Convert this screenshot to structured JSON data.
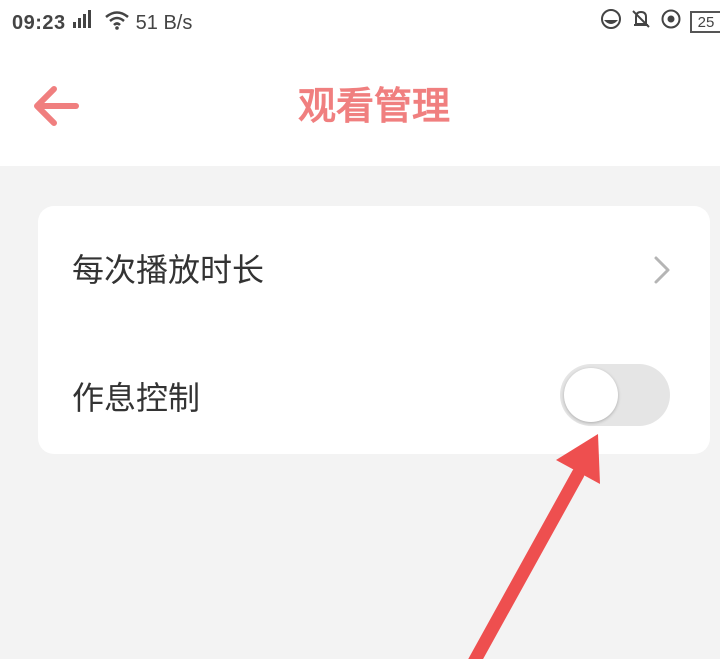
{
  "status_bar": {
    "time": "09:23",
    "network_speed": "51 B/s",
    "battery_level": "25"
  },
  "header": {
    "title": "观看管理"
  },
  "settings": {
    "items": [
      {
        "label": "每次播放时长"
      },
      {
        "label": "作息控制",
        "toggle_on": false
      }
    ]
  },
  "colors": {
    "accent": "#f07f7f",
    "background": "#f3f3f3",
    "annotation_arrow": "#ee4f4f"
  }
}
